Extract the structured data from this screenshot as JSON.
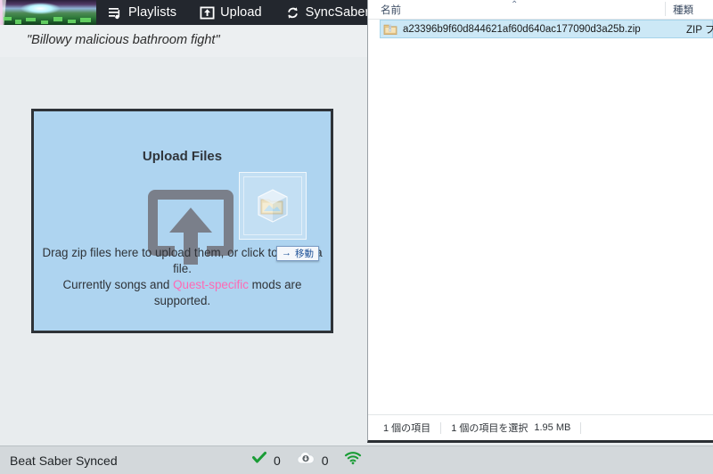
{
  "app": {
    "nav": {
      "banner_name": "site-banner-thumbnail",
      "items": [
        {
          "label": "Playlists",
          "icon": "playlist-icon",
          "name": "nav-item-playlists"
        },
        {
          "label": "Upload",
          "icon": "upload-box-icon",
          "name": "nav-item-upload"
        },
        {
          "label": "SyncSaber",
          "icon": "sync-refresh-icon",
          "name": "nav-item-syncsaber"
        },
        {
          "label": "",
          "icon": "grid-layout-icon",
          "name": "nav-item-partial"
        }
      ]
    },
    "quote": "\"Billowy malicious bathroom fight\"",
    "dropzone": {
      "title": "Upload Files",
      "icon": "upload-arrow-icon",
      "desc_line1": "Drag zip files here to upload them, or click to select a file.",
      "desc_prefix": "Currently songs and ",
      "desc_link": "Quest-specific",
      "desc_suffix": " mods are supported.",
      "background_color": "#aed4f0",
      "border_color": "#2e3338",
      "icon_color": "#7a7f8a",
      "link_color": "#ff69b4"
    },
    "statusbar": {
      "label": "Beat Saber Synced",
      "synced_icon": "green-check-icon",
      "synced_count": "0",
      "download_icon": "cloud-download-icon",
      "download_count": "0",
      "wifi_icon": "wifi-icon",
      "accent_green": "#1a9c36"
    }
  },
  "explorer": {
    "columns": {
      "name": "名前",
      "type": "種類",
      "sort_caret": "⌃"
    },
    "rows": [
      {
        "icon": "zip-file-icon",
        "name": "a23396b9f60d844621af60d640ac177090d3a25b.zip",
        "type": "ZIP ファイル",
        "selected": true
      }
    ],
    "status": {
      "item_count": "1 個の項目",
      "selected": "1 個の項目を選択",
      "size": "1.95 MB"
    },
    "selection_color": "#cce8f6"
  },
  "drag": {
    "ghost_icon": "zip-file-drag-ghost-icon",
    "badge_arrow": "→",
    "badge_label": "移動"
  }
}
